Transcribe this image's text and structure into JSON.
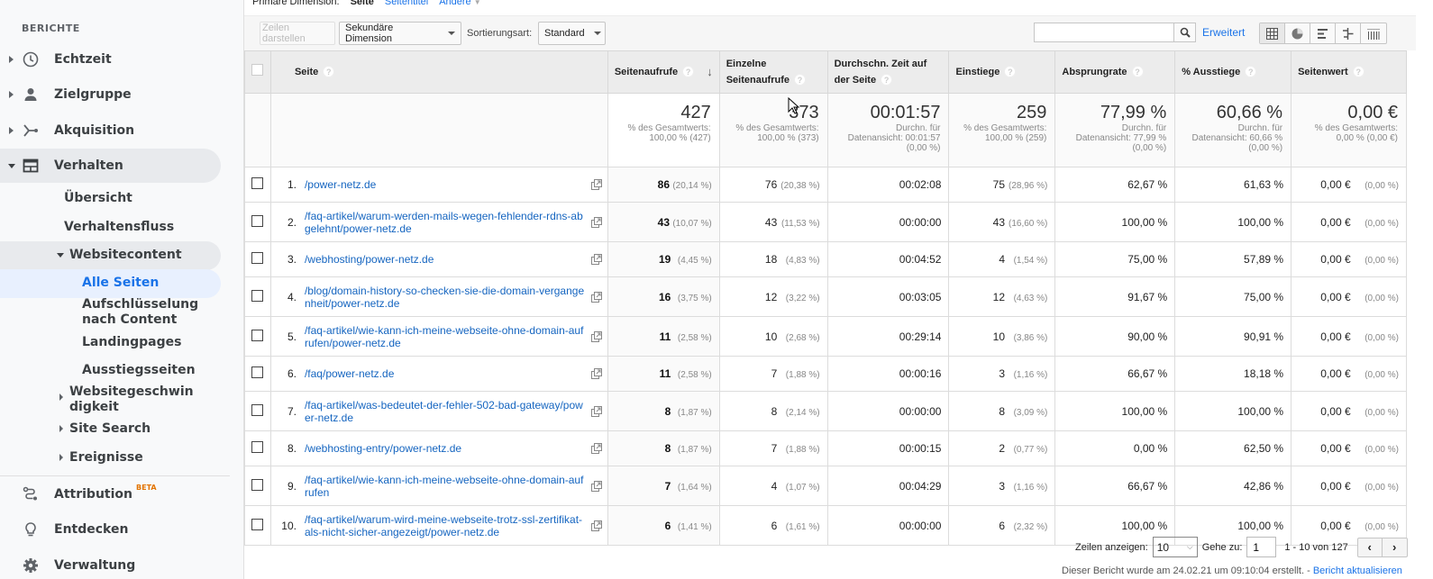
{
  "sidebar": {
    "section": "BERICHTE",
    "items": [
      {
        "label": "Echtzeit",
        "icon": "clock-icon"
      },
      {
        "label": "Zielgruppe",
        "icon": "person-icon"
      },
      {
        "label": "Akquisition",
        "icon": "acquisition-icon"
      },
      {
        "label": "Verhalten",
        "icon": "behavior-icon"
      }
    ],
    "verhalten_sub": [
      "Übersicht",
      "Verhaltensfluss",
      "Websitecontent"
    ],
    "websitecontent_sub": [
      "Alle Seiten",
      "Aufschlüsselung nach Content",
      "Landingpages",
      "Ausstiegsseiten"
    ],
    "verhalten_sub2": [
      "Websitegeschwin digkeit",
      "Site Search",
      "Ereignisse"
    ],
    "bottom": [
      {
        "label": "Attribution",
        "badge": "BETA",
        "icon": "attribution-icon"
      },
      {
        "label": "Entdecken",
        "icon": "lightbulb-icon"
      },
      {
        "label": "Verwaltung",
        "icon": "gear-icon"
      }
    ]
  },
  "dimension": {
    "label": "Primäre Dimension:",
    "current": "Seite",
    "links": [
      "Seitentitel",
      "Andere"
    ]
  },
  "toolbar": {
    "plot_rows": "Zeilen darstellen",
    "secondary_dimension": "Sekundäre Dimension",
    "sort_label": "Sortierungsart:",
    "sort_value": "Standard",
    "search_placeholder": "",
    "advanced": "Erweitert"
  },
  "table": {
    "headers": {
      "page": "Seite",
      "pageviews": "Seitenaufrufe",
      "unique": "Einzelne Seitenaufrufe",
      "avg_time": "Durchschn. Zeit auf der Seite",
      "entrances": "Einstiege",
      "bounce": "Absprungrate",
      "exit": "% Ausstiege",
      "value": "Seitenwert"
    },
    "totals": {
      "pageviews": {
        "big": "427",
        "l1": "% des Gesamtwerts:",
        "l2": "100,00 % (427)"
      },
      "unique": {
        "big": "373",
        "l1": "% des Gesamtwerts:",
        "l2": "100,00 % (373)"
      },
      "avg_time": {
        "big": "00:01:57",
        "l1": "Durchn. für",
        "l2": "Datenansicht: 00:01:57",
        "l3": "(0,00 %)"
      },
      "entrances": {
        "big": "259",
        "l1": "% des Gesamtwerts:",
        "l2": "100,00 % (259)"
      },
      "bounce": {
        "big": "77,99 %",
        "l1": "Durchn. für",
        "l2": "Datenansicht: 77,99 %",
        "l3": "(0,00 %)"
      },
      "exit": {
        "big": "60,66 %",
        "l1": "Durchn. für",
        "l2": "Datenansicht: 60,66 %",
        "l3": "(0,00 %)"
      },
      "value": {
        "big": "0,00 €",
        "l1": "% des Gesamtwerts:",
        "l2": "0,00 % (0,00 €)"
      }
    },
    "rows": [
      {
        "n": "1.",
        "page": "/power-netz.de",
        "pv": "86",
        "pvp": "(20,14 %)",
        "up": "76",
        "upp": "(20,38 %)",
        "t": "00:02:08",
        "e": "75",
        "ep": "(28,96 %)",
        "b": "62,67 %",
        "x": "61,63 %",
        "v": "0,00 €",
        "vp": "(0,00 %)"
      },
      {
        "n": "2.",
        "page": "/faq-artikel/warum-werden-mails-wegen-fehlender-rdns-abgelehnt/power-netz.de",
        "pv": "43",
        "pvp": "(10,07 %)",
        "up": "43",
        "upp": "(11,53 %)",
        "t": "00:00:00",
        "e": "43",
        "ep": "(16,60 %)",
        "b": "100,00 %",
        "x": "100,00 %",
        "v": "0,00 €",
        "vp": "(0,00 %)"
      },
      {
        "n": "3.",
        "page": "/webhosting/power-netz.de",
        "pv": "19",
        "pvp": "(4,45 %)",
        "up": "18",
        "upp": "(4,83 %)",
        "t": "00:04:52",
        "e": "4",
        "ep": "(1,54 %)",
        "b": "75,00 %",
        "x": "57,89 %",
        "v": "0,00 €",
        "vp": "(0,00 %)"
      },
      {
        "n": "4.",
        "page": "/blog/domain-history-so-checken-sie-die-domain-vergangenheit/power-netz.de",
        "pv": "16",
        "pvp": "(3,75 %)",
        "up": "12",
        "upp": "(3,22 %)",
        "t": "00:03:05",
        "e": "12",
        "ep": "(4,63 %)",
        "b": "91,67 %",
        "x": "75,00 %",
        "v": "0,00 €",
        "vp": "(0,00 %)"
      },
      {
        "n": "5.",
        "page": "/faq-artikel/wie-kann-ich-meine-webseite-ohne-domain-aufrufen/power-netz.de",
        "pv": "11",
        "pvp": "(2,58 %)",
        "up": "10",
        "upp": "(2,68 %)",
        "t": "00:29:14",
        "e": "10",
        "ep": "(3,86 %)",
        "b": "90,00 %",
        "x": "90,91 %",
        "v": "0,00 €",
        "vp": "(0,00 %)"
      },
      {
        "n": "6.",
        "page": "/faq/power-netz.de",
        "pv": "11",
        "pvp": "(2,58 %)",
        "up": "7",
        "upp": "(1,88 %)",
        "t": "00:00:16",
        "e": "3",
        "ep": "(1,16 %)",
        "b": "66,67 %",
        "x": "18,18 %",
        "v": "0,00 €",
        "vp": "(0,00 %)"
      },
      {
        "n": "7.",
        "page": "/faq-artikel/was-bedeutet-der-fehler-502-bad-gateway/power-netz.de",
        "pv": "8",
        "pvp": "(1,87 %)",
        "up": "8",
        "upp": "(2,14 %)",
        "t": "00:00:00",
        "e": "8",
        "ep": "(3,09 %)",
        "b": "100,00 %",
        "x": "100,00 %",
        "v": "0,00 €",
        "vp": "(0,00 %)"
      },
      {
        "n": "8.",
        "page": "/webhosting-entry/power-netz.de",
        "pv": "8",
        "pvp": "(1,87 %)",
        "up": "7",
        "upp": "(1,88 %)",
        "t": "00:00:15",
        "e": "2",
        "ep": "(0,77 %)",
        "b": "0,00 %",
        "x": "62,50 %",
        "v": "0,00 €",
        "vp": "(0,00 %)"
      },
      {
        "n": "9.",
        "page": "/faq-artikel/wie-kann-ich-meine-webseite-ohne-domain-aufrufen",
        "pv": "7",
        "pvp": "(1,64 %)",
        "up": "4",
        "upp": "(1,07 %)",
        "t": "00:04:29",
        "e": "3",
        "ep": "(1,16 %)",
        "b": "66,67 %",
        "x": "42,86 %",
        "v": "0,00 €",
        "vp": "(0,00 %)"
      },
      {
        "n": "10.",
        "page": "/faq-artikel/warum-wird-meine-webseite-trotz-ssl-zertifikat-als-nicht-sicher-angezeigt/power-netz.de",
        "pv": "6",
        "pvp": "(1,41 %)",
        "up": "6",
        "upp": "(1,61 %)",
        "t": "00:00:00",
        "e": "6",
        "ep": "(2,32 %)",
        "b": "100,00 %",
        "x": "100,00 %",
        "v": "0,00 €",
        "vp": "(0,00 %)"
      }
    ]
  },
  "pager": {
    "rows_label": "Zeilen anzeigen:",
    "rows_value": "10",
    "goto_label": "Gehe zu:",
    "goto_value": "1",
    "range": "1 - 10 von 127"
  },
  "footer": {
    "text": "Dieser Bericht wurde am 24.02.21 um 09:10:04 erstellt. - ",
    "refresh": "Bericht aktualisieren"
  }
}
